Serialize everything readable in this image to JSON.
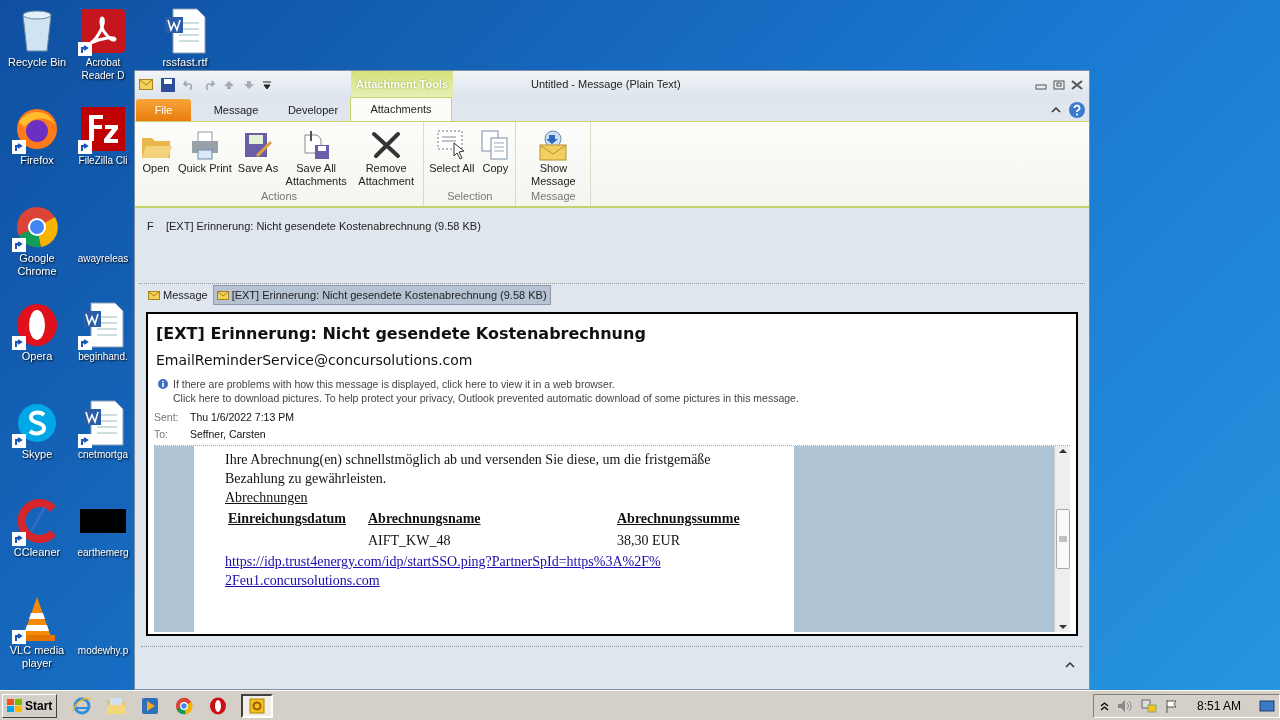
{
  "desktop_icons": [
    {
      "label": "Recycle Bin",
      "kind": "recycle",
      "shortcut": false
    },
    {
      "label": "Acrobat Reader D",
      "kind": "acrobat",
      "shortcut": true
    },
    {
      "label": "rssfast.rtf",
      "kind": "word",
      "shortcut": false
    },
    {
      "label": "Firefox",
      "kind": "firefox",
      "shortcut": true
    },
    {
      "label": "FileZilla Cli",
      "kind": "filezilla",
      "shortcut": true
    },
    {
      "label": "Google Chrome",
      "kind": "chrome",
      "shortcut": true
    },
    {
      "label": "awayreleas",
      "kind": "blank",
      "shortcut": false
    },
    {
      "label": "Opera",
      "kind": "opera",
      "shortcut": true
    },
    {
      "label": "beginhand.",
      "kind": "word",
      "shortcut": true
    },
    {
      "label": "Skype",
      "kind": "skype",
      "shortcut": true
    },
    {
      "label": "cnetmortga",
      "kind": "word",
      "shortcut": true
    },
    {
      "label": "CCleaner",
      "kind": "ccleaner",
      "shortcut": true
    },
    {
      "label": "earthemerg",
      "kind": "black",
      "shortcut": false
    },
    {
      "label": "VLC media player",
      "kind": "vlc",
      "shortcut": true
    },
    {
      "label": "modewhy.p",
      "kind": "blank",
      "shortcut": false
    }
  ],
  "window": {
    "title": "Untitled  -  Message (Plain Text)",
    "contextual_tab": "Attachment Tools",
    "tabs": [
      {
        "label": "File",
        "kind": "file",
        "selected": false
      },
      {
        "label": "Message",
        "kind": "tab",
        "selected": false
      },
      {
        "label": "Developer",
        "kind": "tab",
        "selected": false
      },
      {
        "label": "Attachments",
        "kind": "tab",
        "selected": true
      }
    ],
    "ribbon_groups": [
      {
        "label": "Actions",
        "buttons": [
          {
            "label": "Open",
            "kind": "open"
          },
          {
            "label": "Quick Print",
            "kind": "print"
          },
          {
            "label": "Save As",
            "kind": "saveas"
          },
          {
            "label": "Save All Attachments",
            "kind": "saveall"
          },
          {
            "label": "Remove Attachment",
            "kind": "remove"
          }
        ]
      },
      {
        "label": "Selection",
        "buttons": [
          {
            "label": "Select All",
            "kind": "selectall"
          },
          {
            "label": "Copy",
            "kind": "copy"
          }
        ]
      },
      {
        "label": "Message",
        "buttons": [
          {
            "label": "Show Message",
            "kind": "show"
          }
        ]
      }
    ],
    "attachment_line": "F    [EXT] Erinnerung: Nicht gesendete Kostenabrechnung (9.58 KB)",
    "message_tabs": [
      {
        "label": "Message",
        "selected": false
      },
      {
        "label": "[EXT] Erinnerung: Nicht gesendete Kostenabrechnung (9.58 KB)",
        "selected": true
      }
    ],
    "preview": {
      "subject": "[EXT] Erinnerung: Nicht gesendete Kostenabrechnung",
      "from": "EmailReminderService@concursolutions.com",
      "info": [
        "If there are problems with how this message is displayed, click here to view it in a web browser.",
        "Click here to download pictures. To help protect your privacy, Outlook prevented automatic download of some pictures in this message."
      ],
      "fields": [
        {
          "label": "Sent:",
          "value": "Thu 1/6/2022 7:13 PM"
        },
        {
          "label": "To:",
          "value": "Seffner, Carsten"
        }
      ],
      "body": {
        "paragraph": "Ihre Abrechnung(en) schnellstmöglich ab und versenden Sie diese, um die fristgemäße Bezahlung zu gewährleisten.",
        "link_heading": "Abrechnungen",
        "table": {
          "columns": [
            "Einreichungsdatum",
            "Abrechnungsname",
            "Abrechnungssumme"
          ],
          "rows": [
            [
              "",
              "AIFT_KW_48",
              "38,30 EUR"
            ]
          ]
        },
        "url": "https://idp.trust4energy.com/idp/startSSO.ping?PartnerSpId=https%3A%2F%2Feu1.concursolutions.com"
      }
    }
  },
  "taskbar": {
    "start": "Start",
    "apps": [
      {
        "kind": "ie",
        "selected": false
      },
      {
        "kind": "explorer",
        "selected": false
      },
      {
        "kind": "media",
        "selected": false
      },
      {
        "kind": "chrome",
        "selected": false
      },
      {
        "kind": "opera",
        "selected": false
      },
      {
        "kind": "outlook",
        "selected": true
      }
    ],
    "time": "8:51 AM"
  }
}
